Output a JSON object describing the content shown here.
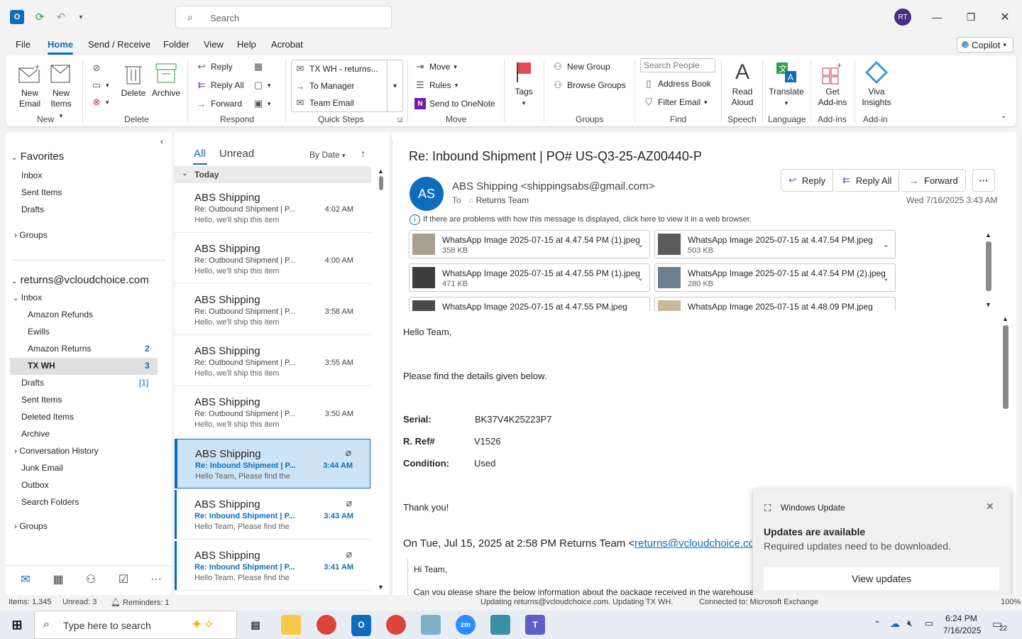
{
  "titlebar": {
    "search_placeholder": "Search",
    "user_initials": "RT"
  },
  "menu": {
    "tabs": [
      "File",
      "Home",
      "Send / Receive",
      "Folder",
      "View",
      "Help",
      "Acrobat"
    ],
    "active": "Home",
    "copilot_label": "Copilot"
  },
  "ribbon": {
    "new_email": "New\nEmail",
    "new_email_l1": "New",
    "new_email_l2": "Email",
    "new_items_l1": "New",
    "new_items_l2": "Items",
    "group_new": "New",
    "delete": "Delete",
    "archive": "Archive",
    "group_delete": "Delete",
    "reply": "Reply",
    "reply_all": "Reply All",
    "forward": "Forward",
    "group_respond": "Respond",
    "quick_steps": [
      "TX WH - returns...",
      "To Manager",
      "Team Email"
    ],
    "group_quick_steps": "Quick Steps",
    "move": "Move",
    "rules": "Rules",
    "send_to_onenote": "Send to OneNote",
    "group_move": "Move",
    "tags": "Tags",
    "new_group": "New Group",
    "browse_groups": "Browse Groups",
    "group_groups": "Groups",
    "search_people_placeholder": "Search People",
    "address_book": "Address Book",
    "filter_email": "Filter Email",
    "group_find": "Find",
    "read_aloud_l1": "Read",
    "read_aloud_l2": "Aloud",
    "group_speech": "Speech",
    "translate": "Translate",
    "group_language": "Language",
    "get_addins_l1": "Get",
    "get_addins_l2": "Add-ins",
    "group_addins": "Add-ins",
    "viva_l1": "Viva",
    "viva_l2": "Insights",
    "group_addin": "Add-in"
  },
  "folders": {
    "favorites_header": "Favorites",
    "favorites": [
      "Inbox",
      "Sent Items",
      "Drafts"
    ],
    "groups1": "Groups",
    "account": "returns@vcloudchoice.com",
    "inbox": "Inbox",
    "subfolders": [
      {
        "name": "Amazon Refunds",
        "count": ""
      },
      {
        "name": "Ewills",
        "count": ""
      },
      {
        "name": "Amazon Returns",
        "count": "2"
      },
      {
        "name": "TX WH",
        "count": "3"
      }
    ],
    "others": [
      {
        "name": "Drafts",
        "count": "[1]"
      },
      {
        "name": "Sent Items",
        "count": ""
      },
      {
        "name": "Deleted Items",
        "count": ""
      },
      {
        "name": "Archive",
        "count": ""
      },
      {
        "name": "Conversation History",
        "count": ""
      },
      {
        "name": "Junk Email",
        "count": ""
      },
      {
        "name": "Outbox",
        "count": ""
      },
      {
        "name": "Search Folders",
        "count": ""
      }
    ],
    "groups2": "Groups"
  },
  "list": {
    "tab_all": "All",
    "tab_unread": "Unread",
    "sort": "By Date",
    "section": "Today",
    "messages": [
      {
        "from": "ABS Shipping",
        "subject": "Re: Outbound Shipment | P...",
        "preview": "Hello,  we'll ship this item",
        "time": "4:02 AM"
      },
      {
        "from": "ABS Shipping",
        "subject": "Re: Outbound Shipment | P...",
        "preview": "Hello,  we'll ship this item",
        "time": "4:00 AM"
      },
      {
        "from": "ABS Shipping",
        "subject": "Re: Outbound Shipment | P...",
        "preview": "Hello,  we'll ship this item",
        "time": "3:58 AM"
      },
      {
        "from": "ABS Shipping",
        "subject": "Re: Outbound Shipment | P...",
        "preview": "Hello,  we'll ship this item",
        "time": "3:55 AM"
      },
      {
        "from": "ABS Shipping",
        "subject": "Re: Outbound Shipment | P...",
        "preview": "Hello,  we'll ship this item",
        "time": "3:50 AM"
      },
      {
        "from": "ABS Shipping",
        "subject": "Re: Inbound Shipment | P...",
        "preview": "Hello Team,  Please find the",
        "time": "3:44 AM"
      },
      {
        "from": "ABS Shipping",
        "subject": "Re: Inbound Shipment | P...",
        "preview": "Hello Team,  Please find the",
        "time": "3:43 AM"
      },
      {
        "from": "ABS Shipping",
        "subject": "Re: Inbound Shipment | P...",
        "preview": "Hello Team,  Please find the",
        "time": "3:41 AM"
      }
    ]
  },
  "reading": {
    "subject": "Re: Inbound Shipment | PO# US-Q3-25-AZ00440-P",
    "avatar": "AS",
    "sender": "ABS Shipping <shippingsabs@gmail.com>",
    "to_label": "To",
    "to": "Returns Team",
    "date": "Wed 7/16/2025 3:43 AM",
    "reply": "Reply",
    "reply_all": "Reply All",
    "forward": "Forward",
    "info": "If there are problems with how this message is displayed, click here to view it in a web browser.",
    "attachments": [
      {
        "name": "WhatsApp Image 2025-07-15 at 4.47.54 PM (1).jpeg",
        "size": "358 KB"
      },
      {
        "name": "WhatsApp Image 2025-07-15 at 4.47.54 PM.jpeg",
        "size": "503 KB"
      },
      {
        "name": "WhatsApp Image 2025-07-15 at 4.47.55 PM (1).jpeg",
        "size": "471 KB"
      },
      {
        "name": "WhatsApp Image 2025-07-15 at 4.47.54 PM (2).jpeg",
        "size": "280 KB"
      },
      {
        "name": "WhatsApp Image 2025-07-15 at 4.47.55 PM.jpeg",
        "size": ""
      },
      {
        "name": "WhatsApp Image 2025-07-15 at 4.48.09 PM.jpeg",
        "size": ""
      }
    ],
    "greeting": "Hello Team,",
    "line1": "Please find the details given below.",
    "serial_label": "Serial:",
    "serial": "BK37V4K25223P7",
    "rref_label": "R. Ref#",
    "rref": "V1526",
    "condition_label": "Condition:",
    "condition": "Used",
    "thanks": "Thank you!",
    "quote_header": "On Tue, Jul 15, 2025 at 2:58 PM Returns Team <",
    "quote_link": "returns@vcloudchoice.com",
    "quote_hi": "Hi Team,",
    "quote_line": "Can you please share the below information about the package received in the warehouse"
  },
  "toast": {
    "app": "Windows Update",
    "title": "Updates are available",
    "text": "Required updates need to be downloaded.",
    "button": "View updates"
  },
  "status": {
    "items": "Items: 1,345",
    "unread": "Unread: 3",
    "reminders": "Reminders: 1",
    "updating": "Updating returns@vcloudchoice.com.  Updating TX WH.",
    "connected": "Connected to: Microsoft Exchange",
    "zoom": "100%"
  },
  "taskbar": {
    "search_placeholder": "Type here to search",
    "time": "6:24 PM",
    "date": "7/16/2025",
    "notifications": "22"
  },
  "colors": {
    "accent": "#0f6cbd",
    "selected_bg": "#cce4f6"
  }
}
